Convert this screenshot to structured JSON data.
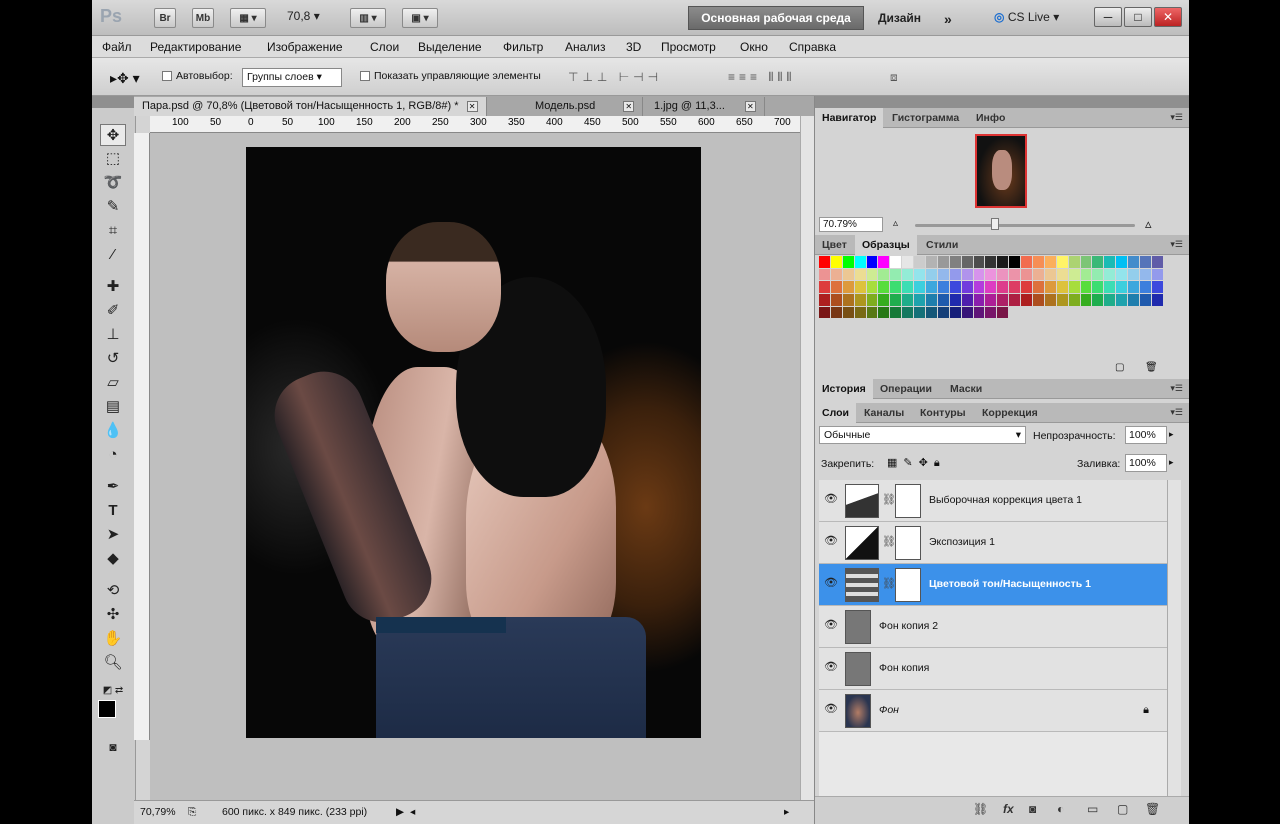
{
  "appbar": {
    "logo": "Ps",
    "bridge_label": "Br",
    "minibridge_label": "Mb",
    "zoom_value": "70,8",
    "workspace_active": "Основная рабочая среда",
    "workspace_design": "Дизайн",
    "more_workspaces": "»",
    "cs_live": "CS Live",
    "minimize": "─",
    "maximize": "□",
    "close": "✕"
  },
  "menu": [
    "Файл",
    "Редактирование",
    "Изображение",
    "Слои",
    "Выделение",
    "Фильтр",
    "Анализ",
    "3D",
    "Просмотр",
    "Окно",
    "Справка"
  ],
  "options": {
    "autoselect_label": "Автовыбор:",
    "autoselect_value": "Группы слоев",
    "show_controls_label": "Показать управляющие элементы"
  },
  "tabs": [
    {
      "label": "Пара.psd @ 70,8% (Цветовой тон/Насыщенность 1, RGB/8#) *"
    },
    {
      "label": "Модель.psd"
    },
    {
      "label": "1.jpg @ 11,3..."
    }
  ],
  "ruler": [
    "100",
    "50",
    "0",
    "50",
    "100",
    "150",
    "200",
    "250",
    "300",
    "350",
    "400",
    "450",
    "500",
    "550",
    "600",
    "650",
    "700"
  ],
  "status": {
    "zoom": "70,79%",
    "doc_info": "600 пикс. x 849 пикс. (233 ppi)"
  },
  "navigator": {
    "tabs": [
      "Навигатор",
      "Гистограмма",
      "Инфо"
    ],
    "zoom": "70.79%"
  },
  "swatches_panel": {
    "tabs": [
      "Цвет",
      "Образцы",
      "Стили"
    ]
  },
  "history_panel": {
    "tabs": [
      "История",
      "Операции",
      "Маски"
    ]
  },
  "layers_panel": {
    "tabs": [
      "Слои",
      "Каналы",
      "Контуры",
      "Коррекция"
    ],
    "blend_mode": "Обычные",
    "opacity_label": "Непрозрачность:",
    "opacity": "100%",
    "lock_label": "Закрепить:",
    "fill_label": "Заливка:",
    "fill": "100%",
    "layers": [
      {
        "name": "Выборочная коррекция цвета 1",
        "type": "adjustment",
        "active": false
      },
      {
        "name": "Экспозиция 1",
        "type": "adjustment",
        "active": false
      },
      {
        "name": "Цветовой тон/Насыщенность 1",
        "type": "adjustment",
        "active": true
      },
      {
        "name": "Фон копия 2",
        "type": "pixel",
        "active": false
      },
      {
        "name": "Фон копия",
        "type": "pixel",
        "active": false
      },
      {
        "name": "Фон",
        "type": "background",
        "active": false
      }
    ]
  },
  "colors": {
    "accent": "#3c91ea",
    "workspace_active_bg": "#7a7a7a"
  }
}
